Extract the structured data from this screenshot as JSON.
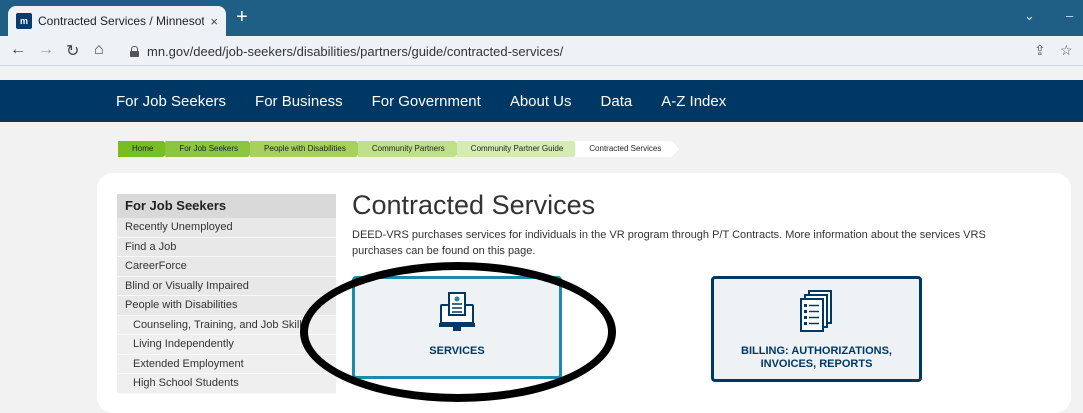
{
  "browser": {
    "tab_title": "Contracted Services / Minnesota",
    "tab_favicon": "m",
    "tab_close": "×",
    "new_tab": "+",
    "url": "mn.gov/deed/job-seekers/disabilities/partners/guide/contracted-services/"
  },
  "nav": {
    "items": [
      "For Job Seekers",
      "For Business",
      "For Government",
      "About Us",
      "Data",
      "A-Z Index"
    ]
  },
  "breadcrumb": [
    "Home",
    "For Job Seekers",
    "People with Disabilities",
    "Community Partners",
    "Community Partner Guide",
    "Contracted Services"
  ],
  "sidebar": {
    "heading": "For Job Seekers",
    "items": [
      {
        "label": "Recently Unemployed",
        "sub": false
      },
      {
        "label": "Find a Job",
        "sub": false
      },
      {
        "label": "CareerForce",
        "sub": false
      },
      {
        "label": "Blind or Visually Impaired",
        "sub": false
      },
      {
        "label": "People with Disabilities",
        "sub": false
      },
      {
        "label": "Counseling, Training, and Job Skills",
        "sub": true
      },
      {
        "label": "Living Independently",
        "sub": true
      },
      {
        "label": "Extended Employment",
        "sub": true
      },
      {
        "label": "High School Students",
        "sub": true
      }
    ]
  },
  "main": {
    "title": "Contracted Services",
    "intro": "DEED-VRS purchases services for individuals in the VR program through P/T Contracts. More information about the services VRS purchases can be found on this page.",
    "cards": [
      {
        "label": "SERVICES",
        "icon": "computer-document-icon"
      },
      {
        "label": "BILLING: AUTHORIZATIONS, INVOICES, REPORTS",
        "icon": "checklist-documents-icon"
      }
    ]
  },
  "colors": {
    "nav_bg": "#003865",
    "accent_teal": "#1d8aa8",
    "breadcrumb_green": "#78be20"
  }
}
